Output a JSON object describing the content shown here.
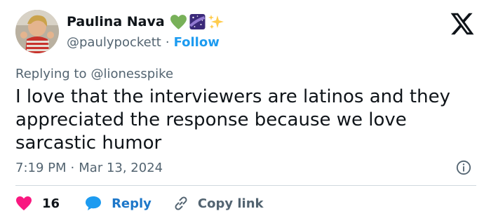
{
  "author": {
    "display_name": "Paulina Nava",
    "emojis": [
      "green-heart",
      "milky-way",
      "sparkles"
    ],
    "handle": "@paulypockett",
    "separator": "·",
    "follow_label": "Follow"
  },
  "reply_context": {
    "prefix": "Replying to",
    "handle": "@lionesspike"
  },
  "tweet": {
    "text": "I love that the interviewers are latinos and they appreciated the response because we love sarcastic humor"
  },
  "meta": {
    "time": "7:19 PM",
    "separator": "·",
    "date": "Mar 13, 2024"
  },
  "actions": {
    "like_count": "16",
    "reply_label": "Reply",
    "copy_label": "Copy link"
  },
  "colors": {
    "accent": "#1d9bf0",
    "like": "#f91880",
    "muted": "#536471",
    "text": "#0f1419",
    "divider": "#cfd9de"
  }
}
